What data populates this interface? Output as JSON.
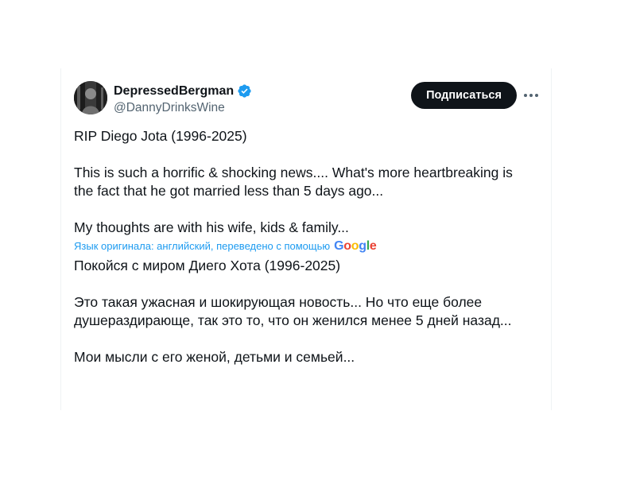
{
  "user": {
    "display_name": "DepressedBergman",
    "handle": "@DannyDrinksWine",
    "verified": true
  },
  "actions": {
    "follow_label": "Подписаться",
    "more_icon": "more-horizontal-icon"
  },
  "tweet": {
    "lines_original": [
      "RIP Diego Jota (1996-2025)",
      "This is such a horrific & shocking news.... What's more heartbreaking is",
      "the fact that he got married less than 5 days ago...",
      "My thoughts are with his wife, kids & family..."
    ],
    "translation_label": "Язык оригинала: английский, переведено с помощью",
    "translation_provider": "Google",
    "lines_translated": [
      "Покойся с миром Диего Хота (1996-2025)",
      "Это такая ужасная и шокирующая новость... Но что еще более",
      "душераздирающе, так это то, что он женился менее 5 дней назад...",
      "Мои мысли с его женой, детьми и семьей..."
    ]
  },
  "colors": {
    "text": "#0f1419",
    "secondary": "#536471",
    "link": "#1d9bf0",
    "verified": "#1d9bf0",
    "button_bg": "#0f1419"
  }
}
